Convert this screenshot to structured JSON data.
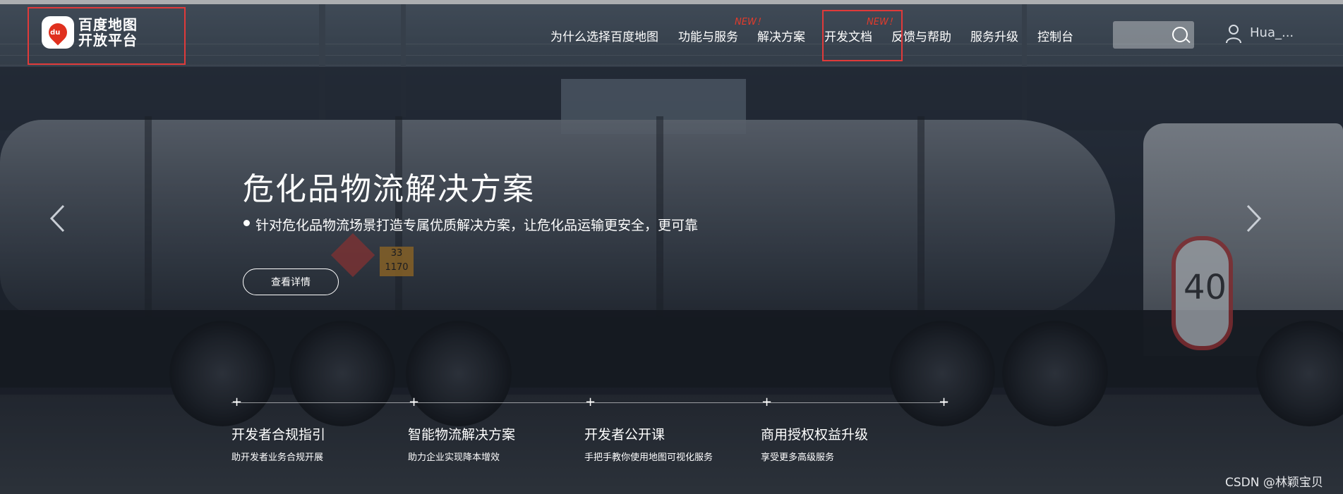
{
  "logo": {
    "badge": "du",
    "line1": "百度地图",
    "line2": "开放平台"
  },
  "nav": {
    "items": [
      {
        "label": "为什么选择百度地图"
      },
      {
        "label": "功能与服务"
      },
      {
        "label": "解决方案"
      },
      {
        "label": "开发文档"
      },
      {
        "label": "反馈与帮助"
      },
      {
        "label": "服务升级"
      },
      {
        "label": "控制台"
      }
    ],
    "new_badge_1": "NEW！",
    "new_badge_2": "NEW！"
  },
  "search": {
    "placeholder": ""
  },
  "user": {
    "name": "Hua_..."
  },
  "slide": {
    "title": "危化品物流解决方案",
    "subtitle": "针对危化品物流场景打造专属优质解决方案，让危化品运输更安全，更可靠",
    "button": "查看详情",
    "prev_icon": "chevron-left-icon",
    "next_icon": "chevron-right-icon"
  },
  "photo": {
    "speed_sign": "40",
    "plate_top": "33",
    "plate_bottom": "1170"
  },
  "cards": [
    {
      "title": "开发者合规指引",
      "subtitle": "助开发者业务合规开展"
    },
    {
      "title": "智能物流解决方案",
      "subtitle": "助力企业实现降本增效"
    },
    {
      "title": "开发者公开课",
      "subtitle": "手把手教你使用地图可视化服务"
    },
    {
      "title": "商用授权权益升级",
      "subtitle": "享受更多高级服务"
    }
  ],
  "watermark": "CSDN @林颖宝贝",
  "colors": {
    "highlight_box": "#e03a3a",
    "new_badge": "#e23b2b"
  }
}
